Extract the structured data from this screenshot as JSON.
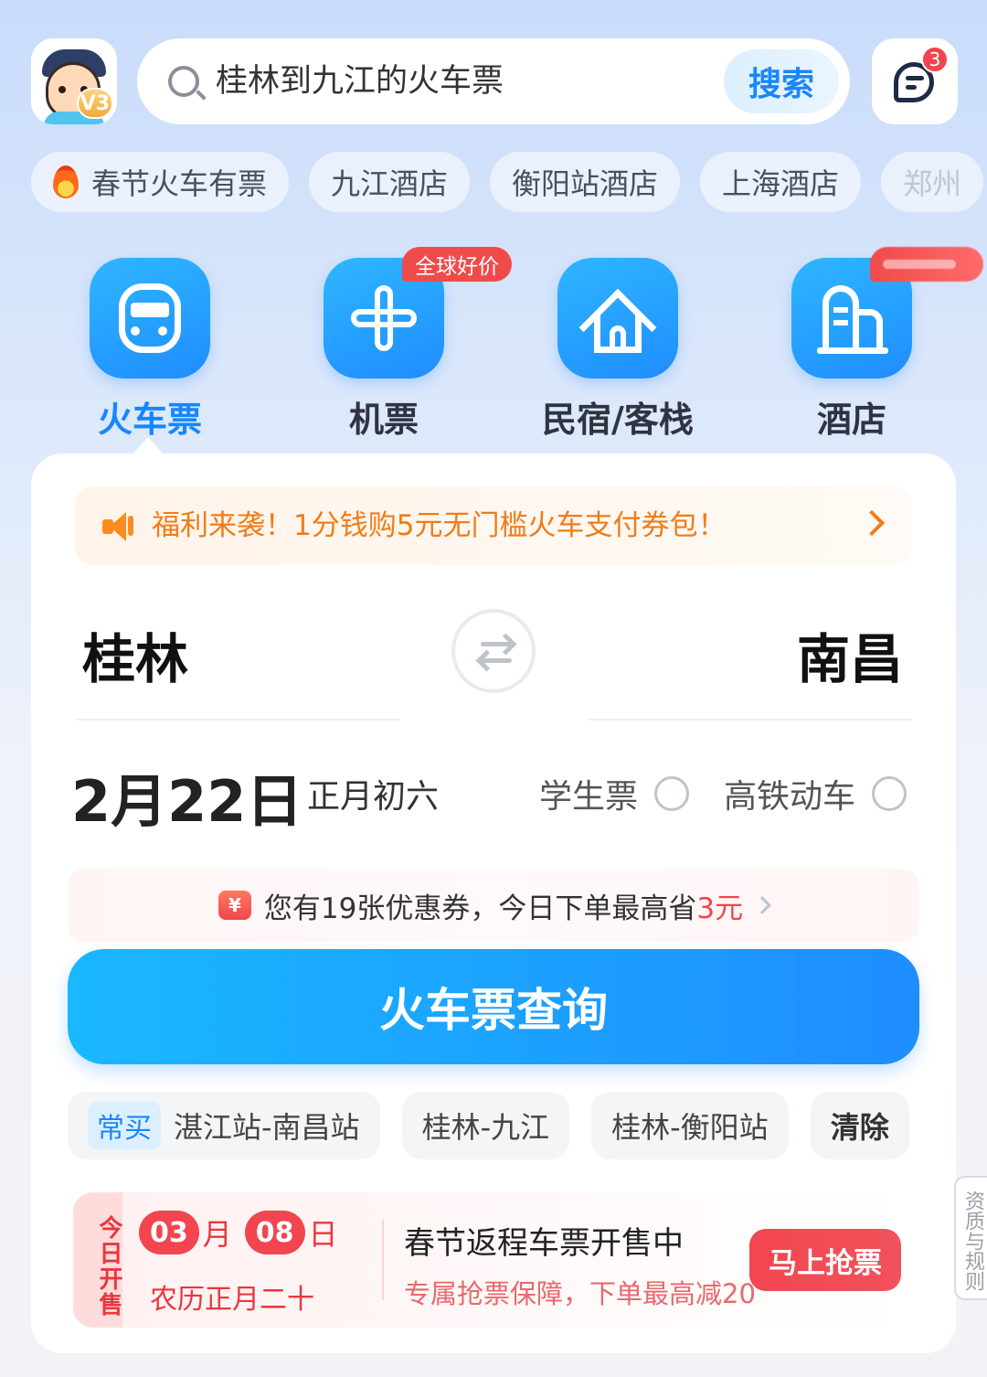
{
  "profile": {
    "level_badge": "V3"
  },
  "search": {
    "query": "桂林到九江的火车票",
    "button_label": "搜索"
  },
  "messages": {
    "badge_count": "3"
  },
  "hot_tags": [
    {
      "label": "春节火车有票",
      "icon": "fire-icon"
    },
    {
      "label": "九江酒店"
    },
    {
      "label": "衡阳站酒店"
    },
    {
      "label": "上海酒店"
    },
    {
      "label": "郑州"
    }
  ],
  "categories": [
    {
      "label": "火车票",
      "icon": "train-icon",
      "active": true
    },
    {
      "label": "机票",
      "icon": "plane-icon",
      "badge": "全球好价"
    },
    {
      "label": "民宿/客栈",
      "icon": "house-icon"
    },
    {
      "label": "酒店",
      "icon": "building-icon"
    }
  ],
  "notice": {
    "text": "福利来袭！1分钱购5元无门槛火车支付券包！"
  },
  "route": {
    "from": "桂林",
    "to": "南昌"
  },
  "date": {
    "main": "2月22日",
    "lunar": "正月初六"
  },
  "options": {
    "student": "学生票",
    "high_speed": "高铁动车"
  },
  "coupon": {
    "prefix": "您有19张优惠券，今日下单最高省",
    "amount": "3元",
    "icon_text": "¥"
  },
  "query_button": "火车票查询",
  "history": {
    "frequent_tag": "常买",
    "items": [
      "湛江站-南昌站",
      "桂林-九江",
      "桂林-衡阳站"
    ],
    "clear_label": "清除"
  },
  "sale": {
    "tag": "今日开售",
    "month": "03",
    "month_unit": "月",
    "day": "08",
    "day_unit": "日",
    "lunar": "农历正月二十",
    "title": "春节返程车票开售中",
    "subtitle": "专属抢票保障，下单最高减20",
    "button": "马上抢票"
  },
  "side_tab": "资质与规则",
  "colors": {
    "accent": "#1786ff",
    "warning": "#f07c18",
    "danger": "#f2454f"
  }
}
